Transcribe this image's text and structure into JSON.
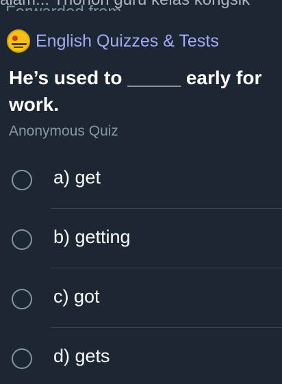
{
  "header": {
    "truncated_line": "alam... Thonon guru kelas kongsik",
    "forwarded_from": "Forwarded from",
    "channel_name": "English Quizzes & Tests"
  },
  "poll": {
    "question": "He’s used to _____ early for work.",
    "type": "Anonymous Quiz",
    "options": [
      {
        "label": "a) get"
      },
      {
        "label": "b) getting"
      },
      {
        "label": "c) got"
      },
      {
        "label": "d) gets"
      }
    ]
  }
}
